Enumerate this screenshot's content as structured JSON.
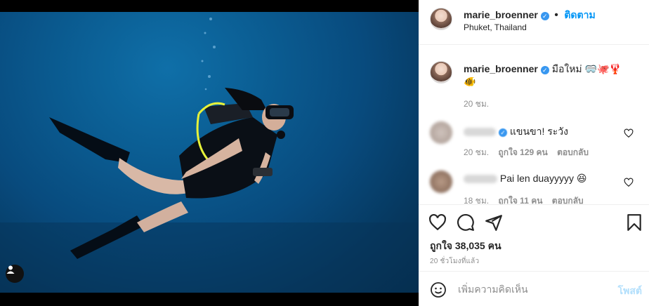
{
  "post": {
    "username": "marie_broenner",
    "verified_icon": "verified-badge-icon",
    "separator": "•",
    "follow_label": "ติดตาม",
    "location": "Phuket, Thailand",
    "caption": {
      "username": "marie_broenner",
      "text": "มือใหม่ 🥽🐙🦞",
      "text2": "🐠",
      "time": "20 ชม."
    },
    "comments": [
      {
        "text": "แขนขา! ระวัง",
        "time": "20 ชม.",
        "likes": "ถูกใจ 129 คน",
        "reply": "ตอบกลับ"
      },
      {
        "text": "Pai len duayyyyy 😆",
        "time": "18 ชม.",
        "likes": "ถูกใจ 11 คน",
        "reply": "ตอบกลับ"
      }
    ],
    "likes_label": "ถูกใจ 38,035 คน",
    "timestamp": "20 ชั่วโมงที่แล้ว",
    "comment_placeholder": "เพิ่มความคิดเห็น",
    "post_label": "โพสต์"
  },
  "colors": {
    "accent": "#0095f6",
    "verified": "#3897f0",
    "ocean": "#0b5f95"
  },
  "icons": [
    "heart-icon",
    "comment-icon",
    "share-icon",
    "bookmark-icon",
    "emoji-icon",
    "user-tag-icon"
  ]
}
